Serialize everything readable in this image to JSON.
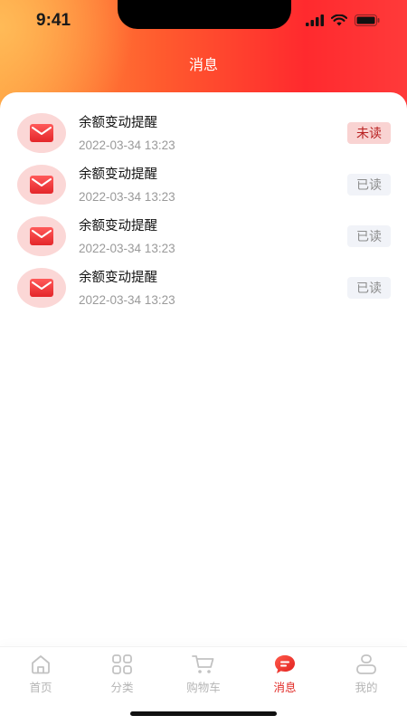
{
  "status_bar": {
    "time": "9:41",
    "icons": [
      "signal-icon",
      "wifi-icon",
      "battery-icon"
    ]
  },
  "header": {
    "title": "消息"
  },
  "messages": [
    {
      "title": "余额变动提醒",
      "time": "2022-03-34 13:23",
      "status": "未读",
      "read": false
    },
    {
      "title": "余额变动提醒",
      "time": "2022-03-34 13:23",
      "status": "已读",
      "read": true
    },
    {
      "title": "余额变动提醒",
      "time": "2022-03-34 13:23",
      "status": "已读",
      "read": true
    },
    {
      "title": "余额变动提醒",
      "time": "2022-03-34 13:23",
      "status": "已读",
      "read": true
    }
  ],
  "tabbar": {
    "items": [
      {
        "label": "首页",
        "icon": "home-icon",
        "active": false
      },
      {
        "label": "分类",
        "icon": "category-grid-icon",
        "active": false
      },
      {
        "label": "购物车",
        "icon": "cart-icon",
        "active": false
      },
      {
        "label": "消息",
        "icon": "message-icon",
        "active": true
      },
      {
        "label": "我的",
        "icon": "profile-icon",
        "active": false
      }
    ]
  },
  "colors": {
    "accent": "#e12a26",
    "header_gradient_start": "#ff9a3c",
    "header_gradient_end": "#ff2a2e",
    "unread_badge_bg": "#f9d3d2",
    "read_badge_bg": "#f1f3f8"
  }
}
